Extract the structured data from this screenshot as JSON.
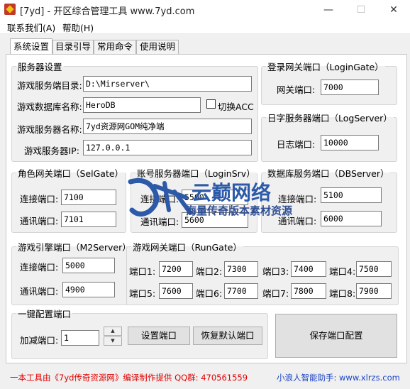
{
  "window": {
    "title": "[7yd] - 开区综合管理工具 www.7yd.com",
    "minimize": "—",
    "maximize": "☐",
    "close": "✕"
  },
  "menu": {
    "contact": "联系我们(A)",
    "help": "帮助(H)"
  },
  "tabs": [
    "系统设置",
    "目录引导",
    "常用命令",
    "使用说明"
  ],
  "server": {
    "title": "服务器设置",
    "dir_label": "游戏服务端目录:",
    "dir_value": "D:\\Mirserver\\",
    "db_label": "游戏数据库名称:",
    "db_value": "HeroDB",
    "acc_label": "切换ACC",
    "name_label": "游戏服务器名称:",
    "name_value": "7yd资源网GOM纯净端",
    "ip_label": "游戏服务器IP:",
    "ip_value": "127.0.0.1"
  },
  "login_gate": {
    "title": "登录网关端口（LoginGate）",
    "label": "网关端口:",
    "value": "7000"
  },
  "log_server": {
    "title": "日字服务器端口（LogServer）",
    "label": "日志端口:",
    "value": "10000"
  },
  "sel_gate": {
    "title": "角色网关端口（SelGate）",
    "conn_label": "连接端口:",
    "conn_value": "7100",
    "comm_label": "通讯端口:",
    "comm_value": "7101"
  },
  "login_srv": {
    "title": "账号服务器端口（LoginSrv）",
    "conn_label": "连接端口:",
    "conn_value": "5500",
    "comm_label": "通讯端口:",
    "comm_value": "5600"
  },
  "db_server": {
    "title": "数据库服务端口（DBServer）",
    "conn_label": "连接端口:",
    "conn_value": "5100",
    "comm_label": "通讯端口:",
    "comm_value": "6000"
  },
  "m2_server": {
    "title": "游戏引擎端口（M2Server）",
    "conn_label": "连接端口:",
    "conn_value": "5000",
    "comm_label": "通讯端口:",
    "comm_value": "4900"
  },
  "run_gate": {
    "title": "游戏网关端口（RunGate）",
    "ports": [
      {
        "label": "端口1:",
        "value": "7200"
      },
      {
        "label": "端口2:",
        "value": "7300"
      },
      {
        "label": "端口3:",
        "value": "7400"
      },
      {
        "label": "端口4:",
        "value": "7500"
      },
      {
        "label": "端口5:",
        "value": "7600"
      },
      {
        "label": "端口6:",
        "value": "7700"
      },
      {
        "label": "端口7:",
        "value": "7800"
      },
      {
        "label": "端口8:",
        "value": "7900"
      }
    ]
  },
  "quick_config": {
    "title": "一键配置端口",
    "inc_label": "加减端口:",
    "inc_value": "1",
    "set_button": "设置端口",
    "reset_button": "恢复默认端口",
    "spin_up": "▲",
    "spin_down": "▼"
  },
  "save_button": "保存端口配置",
  "watermark": {
    "brand": "云巅网络",
    "slogan": "海量传奇版本素材资源"
  },
  "status": {
    "left": "一本工具由《7yd传奇资源网》编译制作提供  QQ群: 470561559",
    "right": "小浪人智能助手: www.xlrzs.com"
  },
  "colors": {
    "status_left": "#e00000",
    "status_right": "#1b44c8",
    "watermark": "#2d5aa8"
  }
}
